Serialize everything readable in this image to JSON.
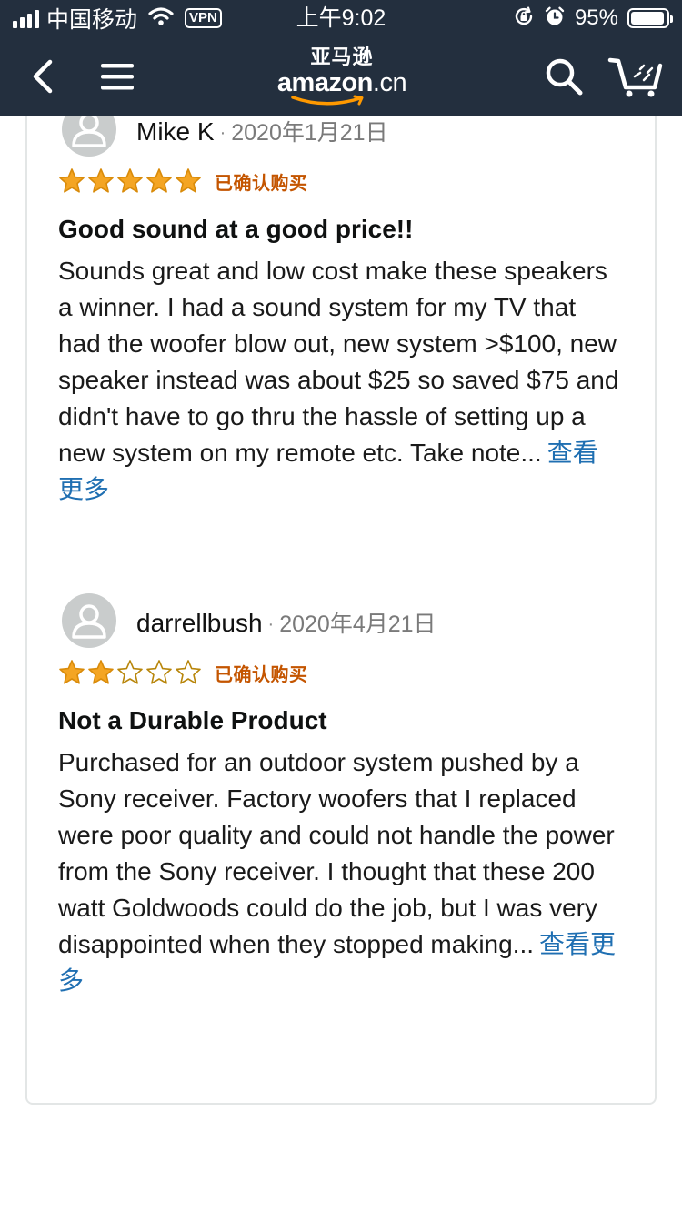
{
  "status_bar": {
    "carrier": "中国移动",
    "vpn": "VPN",
    "time": "上午9:02",
    "battery_percent": "95%",
    "battery_level": 0.95
  },
  "nav": {
    "logo_cn": "亚马逊",
    "logo_en": "amazon",
    "logo_suffix": ".cn",
    "icons": [
      "back-icon",
      "menu-icon",
      "search-icon",
      "cart-icon"
    ]
  },
  "colors": {
    "nav_bg": "#232f3e",
    "star": "#f4a523",
    "verified": "#c45500",
    "link": "#1f6fb2"
  },
  "reviews": [
    {
      "name": "Mike K",
      "separator": "·",
      "date": "2020年1月21日",
      "rating": 5,
      "max_rating": 5,
      "verified": "已确认购买",
      "title": "Good sound at a good price!!",
      "body": "Sounds great and low cost make these speakers a winner. I had a sound system for my TV that had the woofer blow out, new system >$100, new speaker instead was about $25 so saved $75 and didn't have to go thru the hassle of setting up a new system on my remote etc. Take note...",
      "see_more": "查看更多"
    },
    {
      "name": "darrellbush",
      "separator": "·",
      "date": "2020年4月21日",
      "rating": 2,
      "max_rating": 5,
      "verified": "已确认购买",
      "title": "Not a Durable Product",
      "body": "Purchased for an outdoor system pushed by a Sony receiver. Factory woofers that I replaced were poor quality and could not handle the power from the Sony receiver. I thought that these 200 watt Goldwoods could do the job, but I was very disappointed when they stopped making...",
      "see_more": "查看更多"
    }
  ]
}
